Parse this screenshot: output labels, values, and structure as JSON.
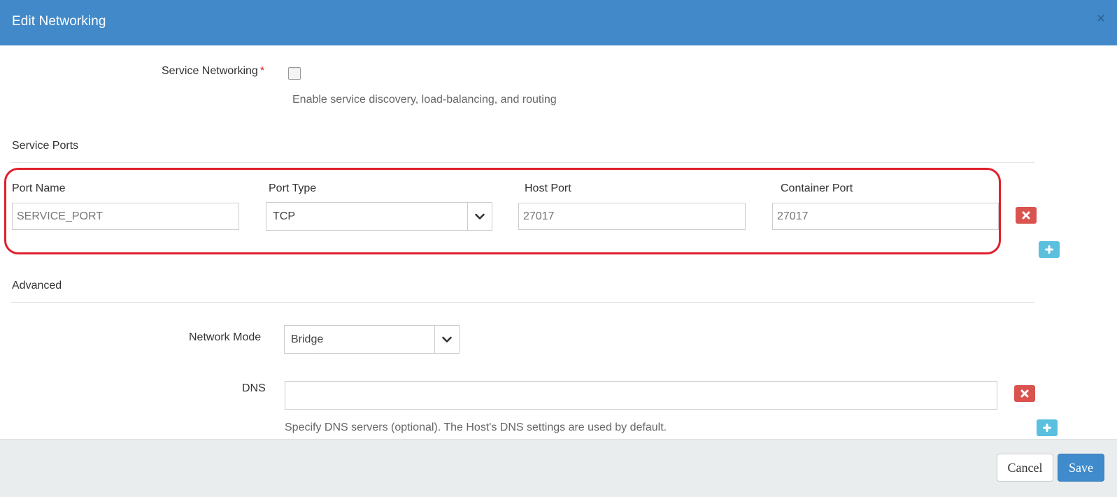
{
  "modal": {
    "title": "Edit Networking",
    "close_glyph": "×"
  },
  "service_networking": {
    "label": "Service Networking",
    "required_mark": "*",
    "checked": false,
    "help": "Enable service discovery, load-balancing, and routing"
  },
  "service_ports": {
    "section_title": "Service Ports",
    "columns": {
      "port_name": "Port Name",
      "port_type": "Port Type",
      "host_port": "Host Port",
      "container_port": "Container Port"
    },
    "row": {
      "port_name": "SERVICE_PORT",
      "port_type": "TCP",
      "host_port": "27017",
      "container_port": "27017"
    }
  },
  "advanced": {
    "section_title": "Advanced",
    "network_mode_label": "Network Mode",
    "network_mode_value": "Bridge",
    "dns_label": "DNS",
    "dns_value": "",
    "dns_help": "Specify DNS servers (optional). The Host's DNS settings are used by default."
  },
  "footer": {
    "cancel_label": "Cancel",
    "save_label": "Save"
  },
  "icons": {
    "remove": "times-icon",
    "add": "plus-icon",
    "dropdown": "chevron-down-icon"
  },
  "colors": {
    "header": "#4189c8",
    "highlight": "#e0202d",
    "danger": "#d9534f",
    "info": "#5bc0de",
    "primary": "#3f8bcb"
  }
}
